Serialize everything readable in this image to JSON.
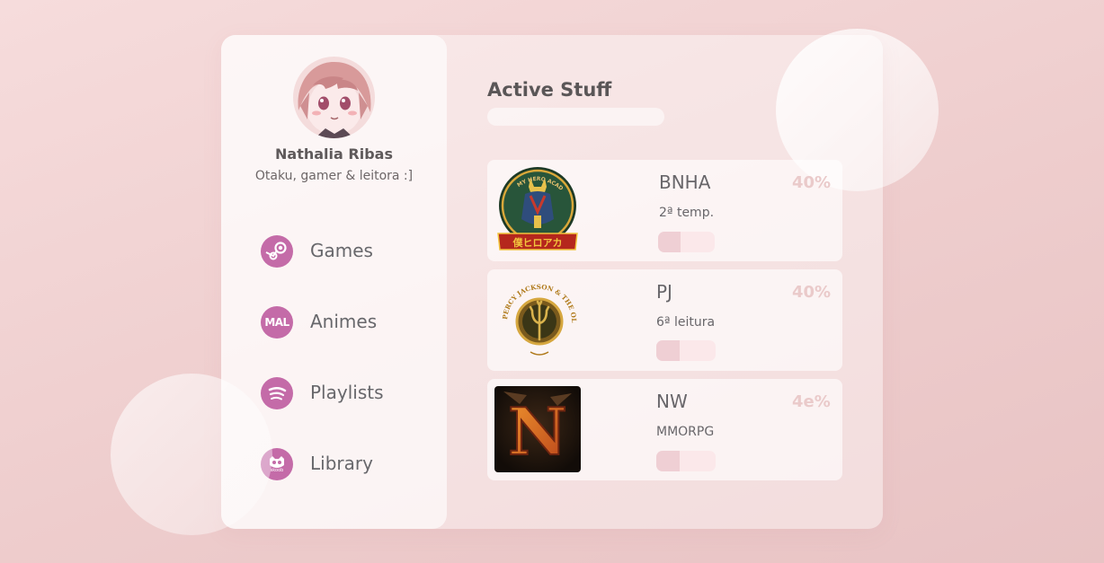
{
  "profile": {
    "name": "Nathalia Ribas",
    "bio": "Otaku, gamer & leitora :]"
  },
  "nav": {
    "items": [
      {
        "label": "Games",
        "icon": "steam-icon"
      },
      {
        "label": "Animes",
        "icon": "mal-icon",
        "icon_text": "MAL"
      },
      {
        "label": "Playlists",
        "icon": "spotify-icon"
      },
      {
        "label": "Library",
        "icon": "skoob-icon",
        "icon_text": "skoob"
      }
    ]
  },
  "main": {
    "title": "Active Stuff",
    "items": [
      {
        "name": "BNHA",
        "sub": "2ª temp.",
        "progress": "40%",
        "bar_fill_percent": 40,
        "thumb": "my-hero-academia-logo",
        "thumb_text": "MY HERO ACADEMIA"
      },
      {
        "name": "PJ",
        "sub": "6ª leitura",
        "progress": "40%",
        "bar_fill_percent": 40,
        "thumb": "percy-jackson-emblem",
        "thumb_text": "PERCY JACKSON & THE OLYMPIANS"
      },
      {
        "name": "NW",
        "sub": "MMORPG",
        "progress": "4e%",
        "bar_fill_percent": 40,
        "thumb": "new-world-logo",
        "thumb_text": "N"
      }
    ]
  },
  "colors": {
    "accent": "#c46ba8",
    "progress_text": "#eacaca",
    "bar_track": "#fbe8ea",
    "bar_fill": "#efcfd4"
  }
}
